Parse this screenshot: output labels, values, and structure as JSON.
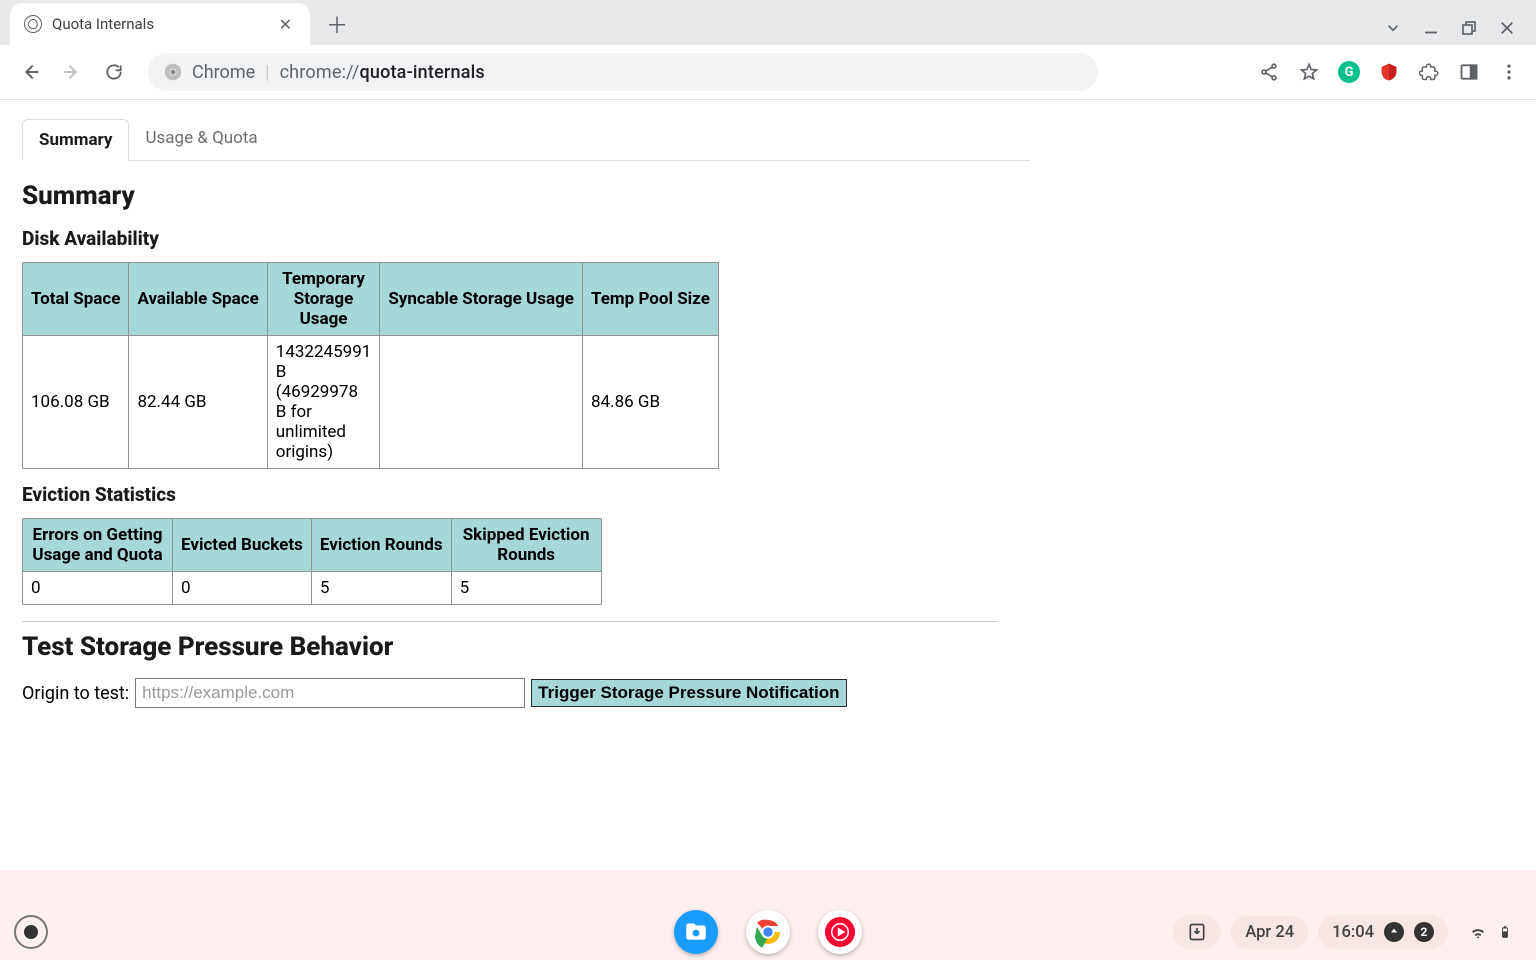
{
  "browser": {
    "tab_title": "Quota Internals",
    "omnibox": {
      "prefix": "Chrome",
      "scheme": "chrome://",
      "path": "quota-internals"
    }
  },
  "page": {
    "tabs": {
      "summary": "Summary",
      "usage_quota": "Usage & Quota",
      "active": "summary"
    },
    "heading": "Summary",
    "disk": {
      "heading": "Disk Availability",
      "headers": [
        "Total Space",
        "Available Space",
        "Temporary Storage Usage",
        "Syncable Storage Usage",
        "Temp Pool Size"
      ],
      "row": {
        "total_space": "106.08 GB",
        "available_space": "82.44 GB",
        "temp_storage_usage": "1432245991 B (46929978 B for unlimited origins)",
        "syncable_storage_usage": "",
        "temp_pool_size": "84.86 GB"
      }
    },
    "eviction": {
      "heading": "Eviction Statistics",
      "headers": [
        "Errors on Getting Usage and Quota",
        "Evicted Buckets",
        "Eviction Rounds",
        "Skipped Eviction Rounds"
      ],
      "row": {
        "errors": "0",
        "evicted_buckets": "0",
        "eviction_rounds": "5",
        "skipped_rounds": "5"
      }
    },
    "pressure": {
      "heading": "Test Storage Pressure Behavior",
      "label": "Origin to test:",
      "placeholder": "https://example.com",
      "button": "Trigger Storage Pressure Notification"
    }
  },
  "shelf": {
    "date": "Apr 24",
    "time": "16:04",
    "notif_count": "2"
  }
}
